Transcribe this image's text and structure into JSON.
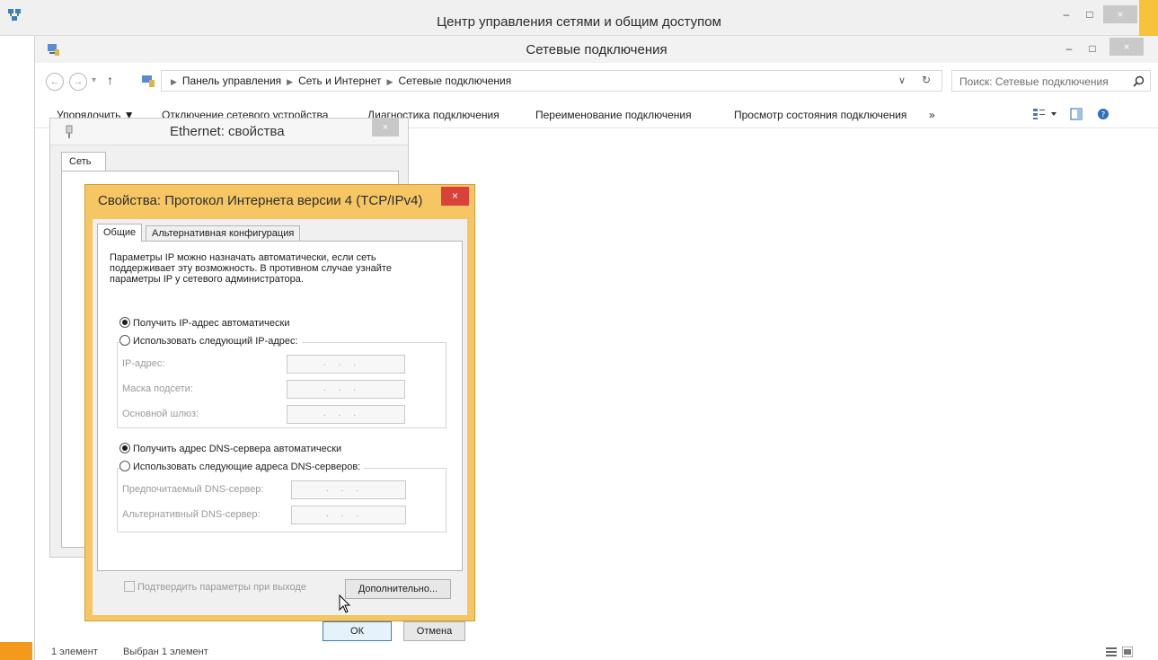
{
  "outer_window": {
    "title": "Центр управления сетями и общим доступом",
    "controls": {
      "minimize": "–",
      "maximize": "□",
      "close": "×"
    }
  },
  "explorer": {
    "title": "Сетевые подключения",
    "controls": {
      "minimize": "–",
      "maximize": "□",
      "close": "×"
    },
    "nav": {
      "back": "←",
      "forward": "→",
      "dropdown": "▾",
      "up": "↑"
    },
    "breadcrumb": [
      "Панель управления",
      "Сеть и Интернет",
      "Сетевые подключения"
    ],
    "address_dropdown": "∨",
    "refresh": "↻",
    "search_placeholder": "Поиск: Сетевые подключения",
    "toolbar": {
      "organize": "Упорядочить ▼",
      "disable_device": "Отключение сетевого устройства",
      "diagnose": "Диагностика подключения",
      "rename": "Переименование подключения",
      "status": "Просмотр состояния подключения",
      "more": "»"
    },
    "status": {
      "count": "1 элемент",
      "selected": "Выбран 1 элемент"
    }
  },
  "ethernet_dialog": {
    "title": "Ethernet: свойства",
    "close": "×",
    "tab": "Сеть"
  },
  "ipv4_dialog": {
    "title": "Свойства: Протокол Интернета версии 4 (TCP/IPv4)",
    "close": "×",
    "tabs": {
      "general": "Общие",
      "alternate": "Альтернативная конфигурация"
    },
    "info_lines": [
      "Параметры IP можно назначать автоматически, если сеть",
      "поддерживает эту возможность. В противном случае узнайте",
      "параметры IP у сетевого администратора."
    ],
    "ip_auto": "Получить IP-адрес автоматически",
    "ip_manual": "Использовать следующий IP-адрес:",
    "ip_address_label": "IP-адрес:",
    "subnet_label": "Маска подсети:",
    "gateway_label": "Основной шлюз:",
    "dns_auto": "Получить адрес DNS-сервера автоматически",
    "dns_manual": "Использовать следующие адреса DNS-серверов:",
    "preferred_dns_label": "Предпочитаемый DNS-сервер:",
    "alternate_dns_label": "Альтернативный DNS-сервер:",
    "ip_placeholder": "...",
    "validate_on_exit": "Подтвердить параметры при выходе",
    "advanced_button": "Дополнительно...",
    "ok_button": "ОК",
    "cancel_button": "Отмена",
    "ip_auto_selected": true,
    "dns_auto_selected": true,
    "validate_checked": false
  },
  "colors": {
    "dialog_accent": "#f5c663",
    "close_red": "#d9423a",
    "start_orange": "#f39a1d"
  }
}
